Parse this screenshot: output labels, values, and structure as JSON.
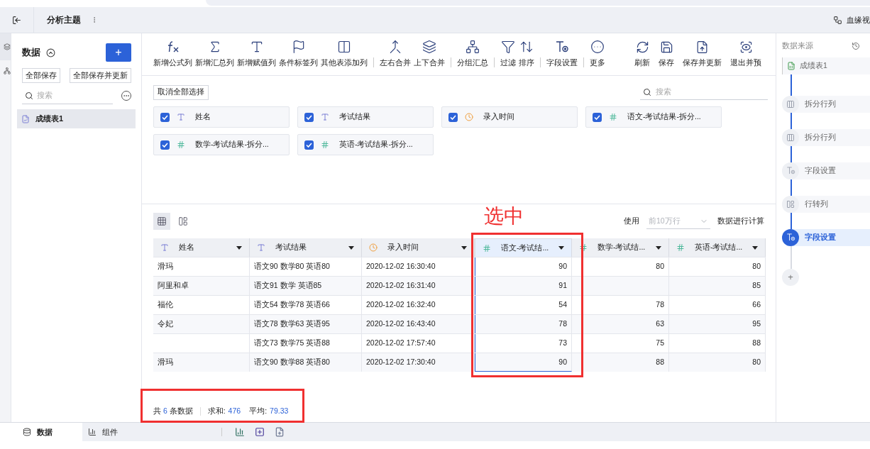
{
  "header": {
    "title": "分析主题",
    "lineage": "血缘视"
  },
  "left_panel": {
    "title": "数据",
    "add": "+",
    "buttons": [
      "全部保存",
      "全部保存并更新"
    ],
    "search": {
      "placeholder": "搜索"
    },
    "items": [
      {
        "label": "成绩表1",
        "selected": true
      }
    ]
  },
  "toolbar": {
    "groups": [
      [
        "新增公式列",
        "新增汇总列",
        "新增赋值列",
        "条件标签列",
        "其他表添加列"
      ],
      [
        "左右合并",
        "上下合并"
      ],
      [
        "分组汇总"
      ],
      [
        "过滤",
        "排序"
      ],
      [
        "字段设置"
      ],
      [
        "更多"
      ]
    ],
    "right": [
      "刷新",
      "保存",
      "保存并更新",
      "退出并预"
    ]
  },
  "fields": {
    "clear_button": "取消全部选择",
    "search": {
      "placeholder": "搜索"
    },
    "items": [
      {
        "label": "姓名",
        "kind": "text",
        "checked": true
      },
      {
        "label": "考试结果",
        "kind": "text",
        "checked": true
      },
      {
        "label": "录入时间",
        "kind": "time",
        "checked": true
      },
      {
        "label": "语文-考试结果-拆分...",
        "kind": "number",
        "checked": true
      },
      {
        "label": "数学-考试结果-拆分...",
        "kind": "number",
        "checked": true
      },
      {
        "label": "英语-考试结果-拆分...",
        "kind": "number",
        "checked": true
      }
    ]
  },
  "table": {
    "views": [
      {
        "selected": true
      },
      {
        "selected": false
      }
    ],
    "use_label": "使用",
    "rows_limit": {
      "placeholder": "前10万行"
    },
    "calc_label": "数据进行计算",
    "columns": [
      {
        "label": "姓名",
        "kind": "text",
        "selected": false
      },
      {
        "label": "考试结果",
        "kind": "text",
        "selected": false
      },
      {
        "label": "录入时间",
        "kind": "time",
        "selected": false
      },
      {
        "label": "语文-考试结...",
        "kind": "number",
        "selected": true
      },
      {
        "label": "数学-考试结...",
        "kind": "number",
        "selected": false
      },
      {
        "label": "英语-考试结...",
        "kind": "number",
        "selected": false
      }
    ],
    "rows": [
      [
        "滑玛",
        "语文90 数学80 英语80",
        "2020-12-02 16:30:40",
        "90",
        "80",
        "80"
      ],
      [
        "阿里和卓",
        "语文91 数学 英语85",
        "2020-12-02 16:31:40",
        "91",
        null,
        "85"
      ],
      [
        "福伦",
        "语文54 数学78 英语66",
        "2020-12-02 16:32:40",
        "54",
        "78",
        "66"
      ],
      [
        "令妃",
        "语文78 数学63 英语95",
        "2020-12-02 16:43:40",
        "78",
        "63",
        "95"
      ],
      [
        null,
        "语文73 数学75 英语88",
        "2020-12-02 17:57:40",
        "73",
        "75",
        "88"
      ],
      [
        "滑玛",
        "语文90 数学88 英语80",
        "2020-12-02 17:30:40",
        "90",
        "88",
        "80"
      ]
    ]
  },
  "stats": {
    "count_prefix": "共",
    "count": "6",
    "count_suffix": "条数据",
    "sum_label": "求和:",
    "sum": "476",
    "avg_label": "平均:",
    "avg": "79.33"
  },
  "right_panel": {
    "title": "数据来源",
    "source": "成绩表1",
    "steps": [
      {
        "label": "拆分行列",
        "kind": "split",
        "selected": false
      },
      {
        "label": "拆分行列",
        "kind": "split",
        "selected": false
      },
      {
        "label": "字段设置",
        "kind": "field",
        "selected": false
      },
      {
        "label": "行转列",
        "kind": "pivot",
        "selected": false
      },
      {
        "label": "字段设置",
        "kind": "field",
        "selected": true
      }
    ],
    "add": "+"
  },
  "bottom_tabs": [
    {
      "label": "数据",
      "selected": true
    },
    {
      "label": "组件",
      "selected": false
    }
  ],
  "annotation": {
    "label": "选中"
  }
}
